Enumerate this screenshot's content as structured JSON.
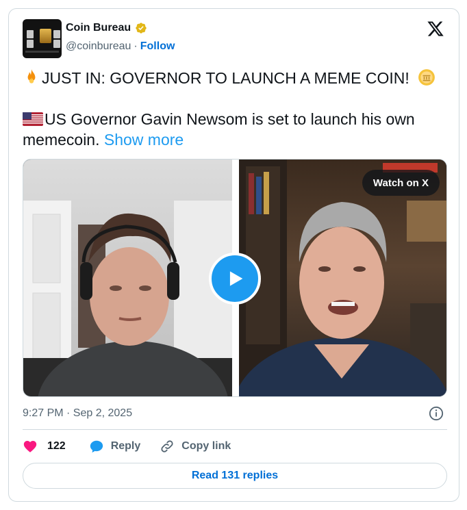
{
  "author": {
    "name": "Coin Bureau",
    "handle": "@coinbureau",
    "separator": "·",
    "follow_label": "Follow"
  },
  "tweet": {
    "line1": "JUST IN: GOVERNOR TO LAUNCH A MEME COIN!",
    "line2_prefix": "US Governor Gavin Newsom is set to launch his own memecoin.",
    "show_more": "Show more"
  },
  "media": {
    "watch_label": "Watch on X"
  },
  "footer": {
    "timestamp": "9:27 PM · Sep 2, 2025",
    "like_count": "122",
    "reply_label": "Reply",
    "copy_label": "Copy link",
    "read_replies": "Read 131 replies"
  },
  "colors": {
    "accent": "#1d9bf0",
    "link": "#006fd6",
    "like": "#f91880",
    "muted": "#536471",
    "verified": "#e2b719"
  },
  "icons": [
    "verified-badge-icon",
    "x-logo-icon",
    "fire-icon",
    "coin-icon",
    "us-flag-icon",
    "play-icon",
    "info-icon",
    "heart-icon",
    "reply-icon",
    "link-icon"
  ]
}
